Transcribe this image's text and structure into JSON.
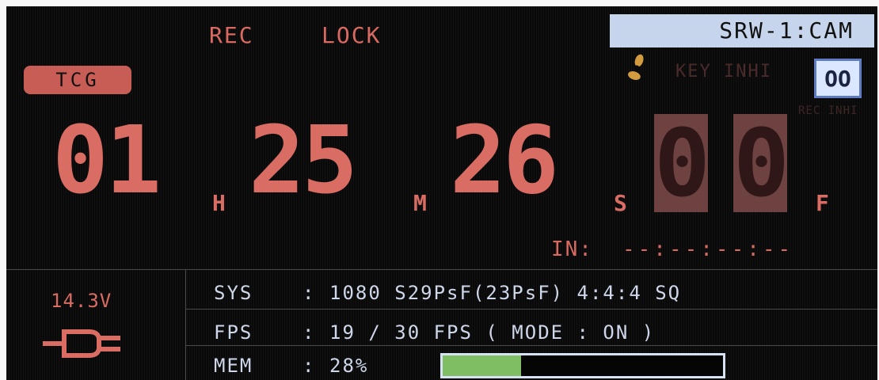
{
  "status": {
    "rec": "REC",
    "lock": "LOCK",
    "device": "SRW-1:CAM",
    "mode_badge": "TCG",
    "key_inhibit": "KEY INHI",
    "rec_inhibit": "REC INHI",
    "rec_inhibit_icon_text": "OO"
  },
  "timecode": {
    "hours": "01",
    "hours_unit": "H",
    "minutes": "25",
    "minutes_unit": "M",
    "seconds": "26",
    "seconds_unit": "S",
    "frames": "00",
    "frames_unit": "F"
  },
  "in_point": {
    "label": "IN:",
    "value": "--:--:--:--"
  },
  "power": {
    "voltage": "14.3V",
    "icon": "plug-icon"
  },
  "info": {
    "sys_label": "SYS",
    "sys_value": "1080 S29PsF(23PsF) 4:4:4 SQ",
    "fps_label": "FPS",
    "fps_value": "19 / 30 FPS ( MODE : ON )",
    "mem_label": "MEM",
    "mem_value": "28%",
    "colon": ":"
  },
  "memory": {
    "used_percent": 28
  },
  "icons": {
    "fan": "fan-icon",
    "rec_inhibit": "rec-inhibit-icon"
  },
  "colors": {
    "red": "#d96c63",
    "pale_blue": "#cfd7ea",
    "badge_blue": "#c7d5ec",
    "memory_fill": "#7fbe63"
  }
}
